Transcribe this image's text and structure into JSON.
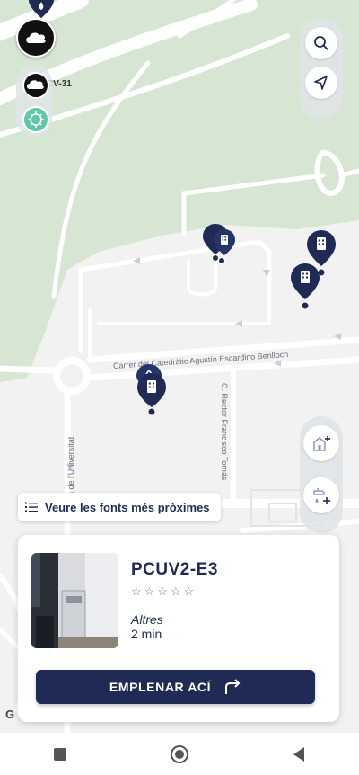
{
  "map": {
    "street_labels": {
      "catedratic": "Carrer del Catedràtic Agustín Escardino Benlloch",
      "rector": "C. Rector Francisco Tomás",
      "universitat": "a de l'Universitat",
      "highway": "CV-31"
    },
    "google_mark": "G"
  },
  "controls": {
    "search_icon": "search-icon",
    "locate_icon": "navigation-arrow-icon",
    "add_building_icon": "building-add-icon",
    "add_tap_icon": "tap-add-icon"
  },
  "nearest_button": {
    "label": "Veure les fonts més pròximes",
    "icon": "list-icon"
  },
  "fountain_card": {
    "name": "PCUV2-E3",
    "rating": 0,
    "rating_max": 5,
    "category": "Altres",
    "duration": "2 min",
    "action_label": "EMPLENAR ACÍ",
    "action_icon": "turn-right-arrow-icon"
  },
  "navbar": {
    "items": [
      "recent-apps-icon",
      "home-icon",
      "back-icon"
    ]
  },
  "colors": {
    "brand_navy": "#1f2b55",
    "map_green": "#d6e6d3",
    "map_road": "#ffffff",
    "map_bg": "#f2f2f2"
  }
}
